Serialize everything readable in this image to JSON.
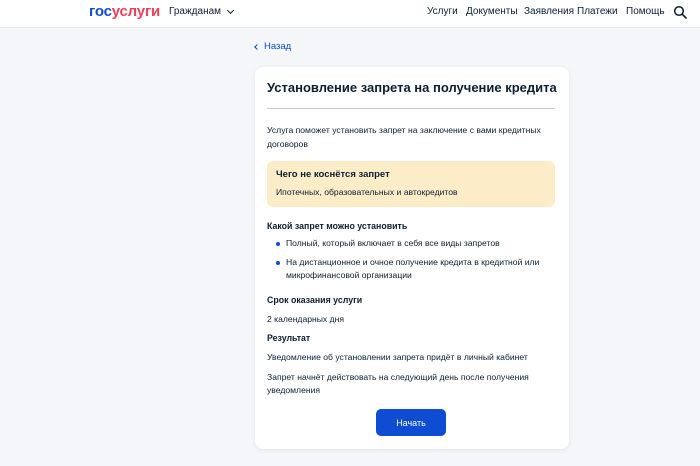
{
  "header": {
    "logo_part1": "гос",
    "logo_part2": "услуги",
    "audience": "Гражданам",
    "nav": [
      "Услуги",
      "Документы",
      "Заявления",
      "Платежи",
      "Помощь"
    ]
  },
  "back_label": "Назад",
  "card": {
    "title": "Установление запрета на получение кредита",
    "intro": "Услуга поможет установить запрет на заключение с вами кредитных договоров",
    "notice_title": "Чего не коснётся запрет",
    "notice_text": "Ипотечных, образовательных и автокредитов",
    "ban_heading": "Какой запрет можно установить",
    "ban_items": [
      "Полный, который включает в себя все виды запретов",
      "На дистанционное и очное получение кредита в кредитной или микрофинансовой организации"
    ],
    "term_heading": "Срок оказания услуги",
    "term_text": "2 календарных дня",
    "result_heading": "Результат",
    "result_text1": "Уведомление об установлении запрета придёт в личный кабинет",
    "result_text2": "Запрет начнёт действовать на следующий день после получения уведомления",
    "start_button": "Начать"
  },
  "colors": {
    "brand_blue": "#0d4cd3",
    "brand_red": "#ee3f58",
    "notice_bg": "#fdecc8",
    "page_bg": "#f4f6f9"
  },
  "icons": [
    "search-icon",
    "chevron-down-icon",
    "chevron-left-icon"
  ]
}
